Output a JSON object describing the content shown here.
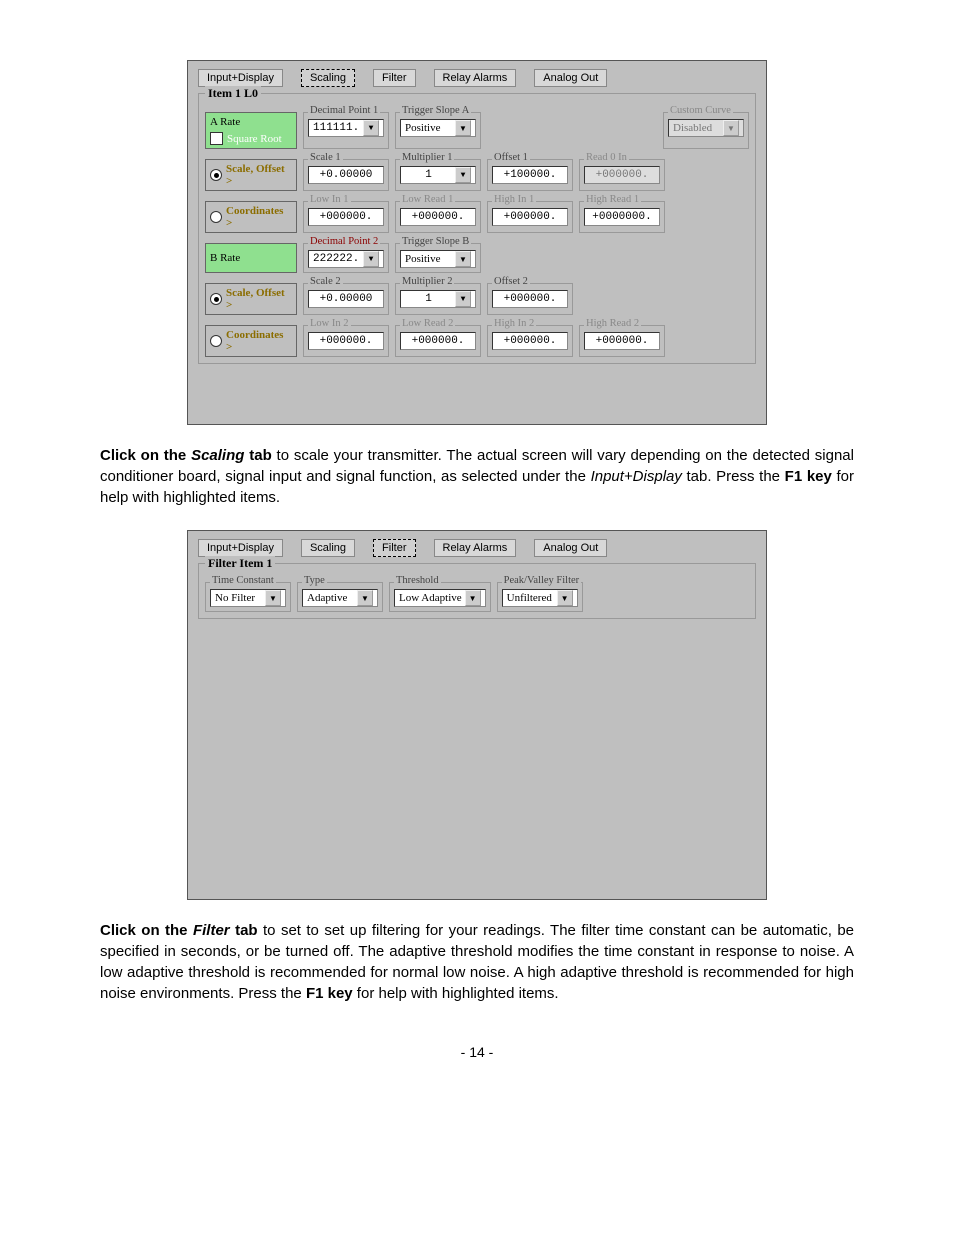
{
  "tabs": {
    "input_display": "Input+Display",
    "scaling": "Scaling",
    "filter": "Filter",
    "relay_alarms": "Relay Alarms",
    "analog_out": "Analog Out"
  },
  "scaling": {
    "group_title": "Item 1  L0",
    "a_rate": "A Rate",
    "square_root": "Square Root",
    "scale_offset": "Scale, Offset >",
    "coordinates": "Coordinates  >",
    "b_rate": "B Rate",
    "decimal_point_1": {
      "label": "Decimal Point 1",
      "value": "111111."
    },
    "trigger_slope_a": {
      "label": "Trigger Slope A",
      "value": "Positive"
    },
    "custom_curve": {
      "label": "Custom Curve",
      "value": "Disabled"
    },
    "scale_1": {
      "label": "Scale 1",
      "value": "+0.00000"
    },
    "multiplier_1": {
      "label": "Multiplier 1",
      "value": "1"
    },
    "offset_1": {
      "label": "Offset 1",
      "value": "+100000."
    },
    "read_0_in": {
      "label": "Read 0 In",
      "value": "+000000."
    },
    "low_in_1": {
      "label": "Low In 1",
      "value": "+000000."
    },
    "low_read_1": {
      "label": "Low Read 1",
      "value": "+000000."
    },
    "high_in_1": {
      "label": "High In 1",
      "value": "+000000."
    },
    "high_read_1": {
      "label": "High Read 1",
      "value": "+0000000."
    },
    "decimal_point_2": {
      "label": "Decimal Point 2",
      "value": "222222."
    },
    "trigger_slope_b": {
      "label": "Trigger Slope B",
      "value": "Positive"
    },
    "scale_2": {
      "label": "Scale 2",
      "value": "+0.00000"
    },
    "multiplier_2": {
      "label": "Multiplier 2",
      "value": "1"
    },
    "offset_2": {
      "label": "Offset 2",
      "value": "+000000."
    },
    "low_in_2": {
      "label": "Low In 2",
      "value": "+000000."
    },
    "low_read_2": {
      "label": "Low Read 2",
      "value": "+000000."
    },
    "high_in_2": {
      "label": "High In 2",
      "value": "+000000."
    },
    "high_read_2": {
      "label": "High Read 2",
      "value": "+000000."
    }
  },
  "filter": {
    "group_title": "Filter  Item 1",
    "time_constant": {
      "label": "Time Constant",
      "value": "No Filter"
    },
    "type": {
      "label": "Type",
      "value": "Adaptive"
    },
    "threshold": {
      "label": "Threshold",
      "value": "Low Adaptive"
    },
    "peak_valley": {
      "label": "Peak/Valley Filter",
      "value": "Unfiltered"
    }
  },
  "para1": {
    "t1": "Click on the ",
    "t2": "Scaling",
    "t3": " tab",
    "t4": " to scale your transmitter. The actual screen will vary depending on the detected signal conditioner board, signal input and signal function, as selected under the ",
    "t5": "Input+Display",
    "t6": " tab. Press the ",
    "t7": "F1 key",
    "t8": " for help with highlighted items."
  },
  "para2": {
    "t1": "Click on the ",
    "t2": "Filter",
    "t3": " tab",
    "t4": " to set to set up filtering for your readings. The filter time constant can be automatic, be specified in seconds, or be turned off. The adaptive threshold modifies the time constant in response to noise. A low adaptive threshold is recommended for normal low noise. A high adaptive threshold is recommended for high noise environments. Press the ",
    "t5": "F1 key",
    "t6": " for help with highlighted items."
  },
  "page_number": "- 14 -"
}
